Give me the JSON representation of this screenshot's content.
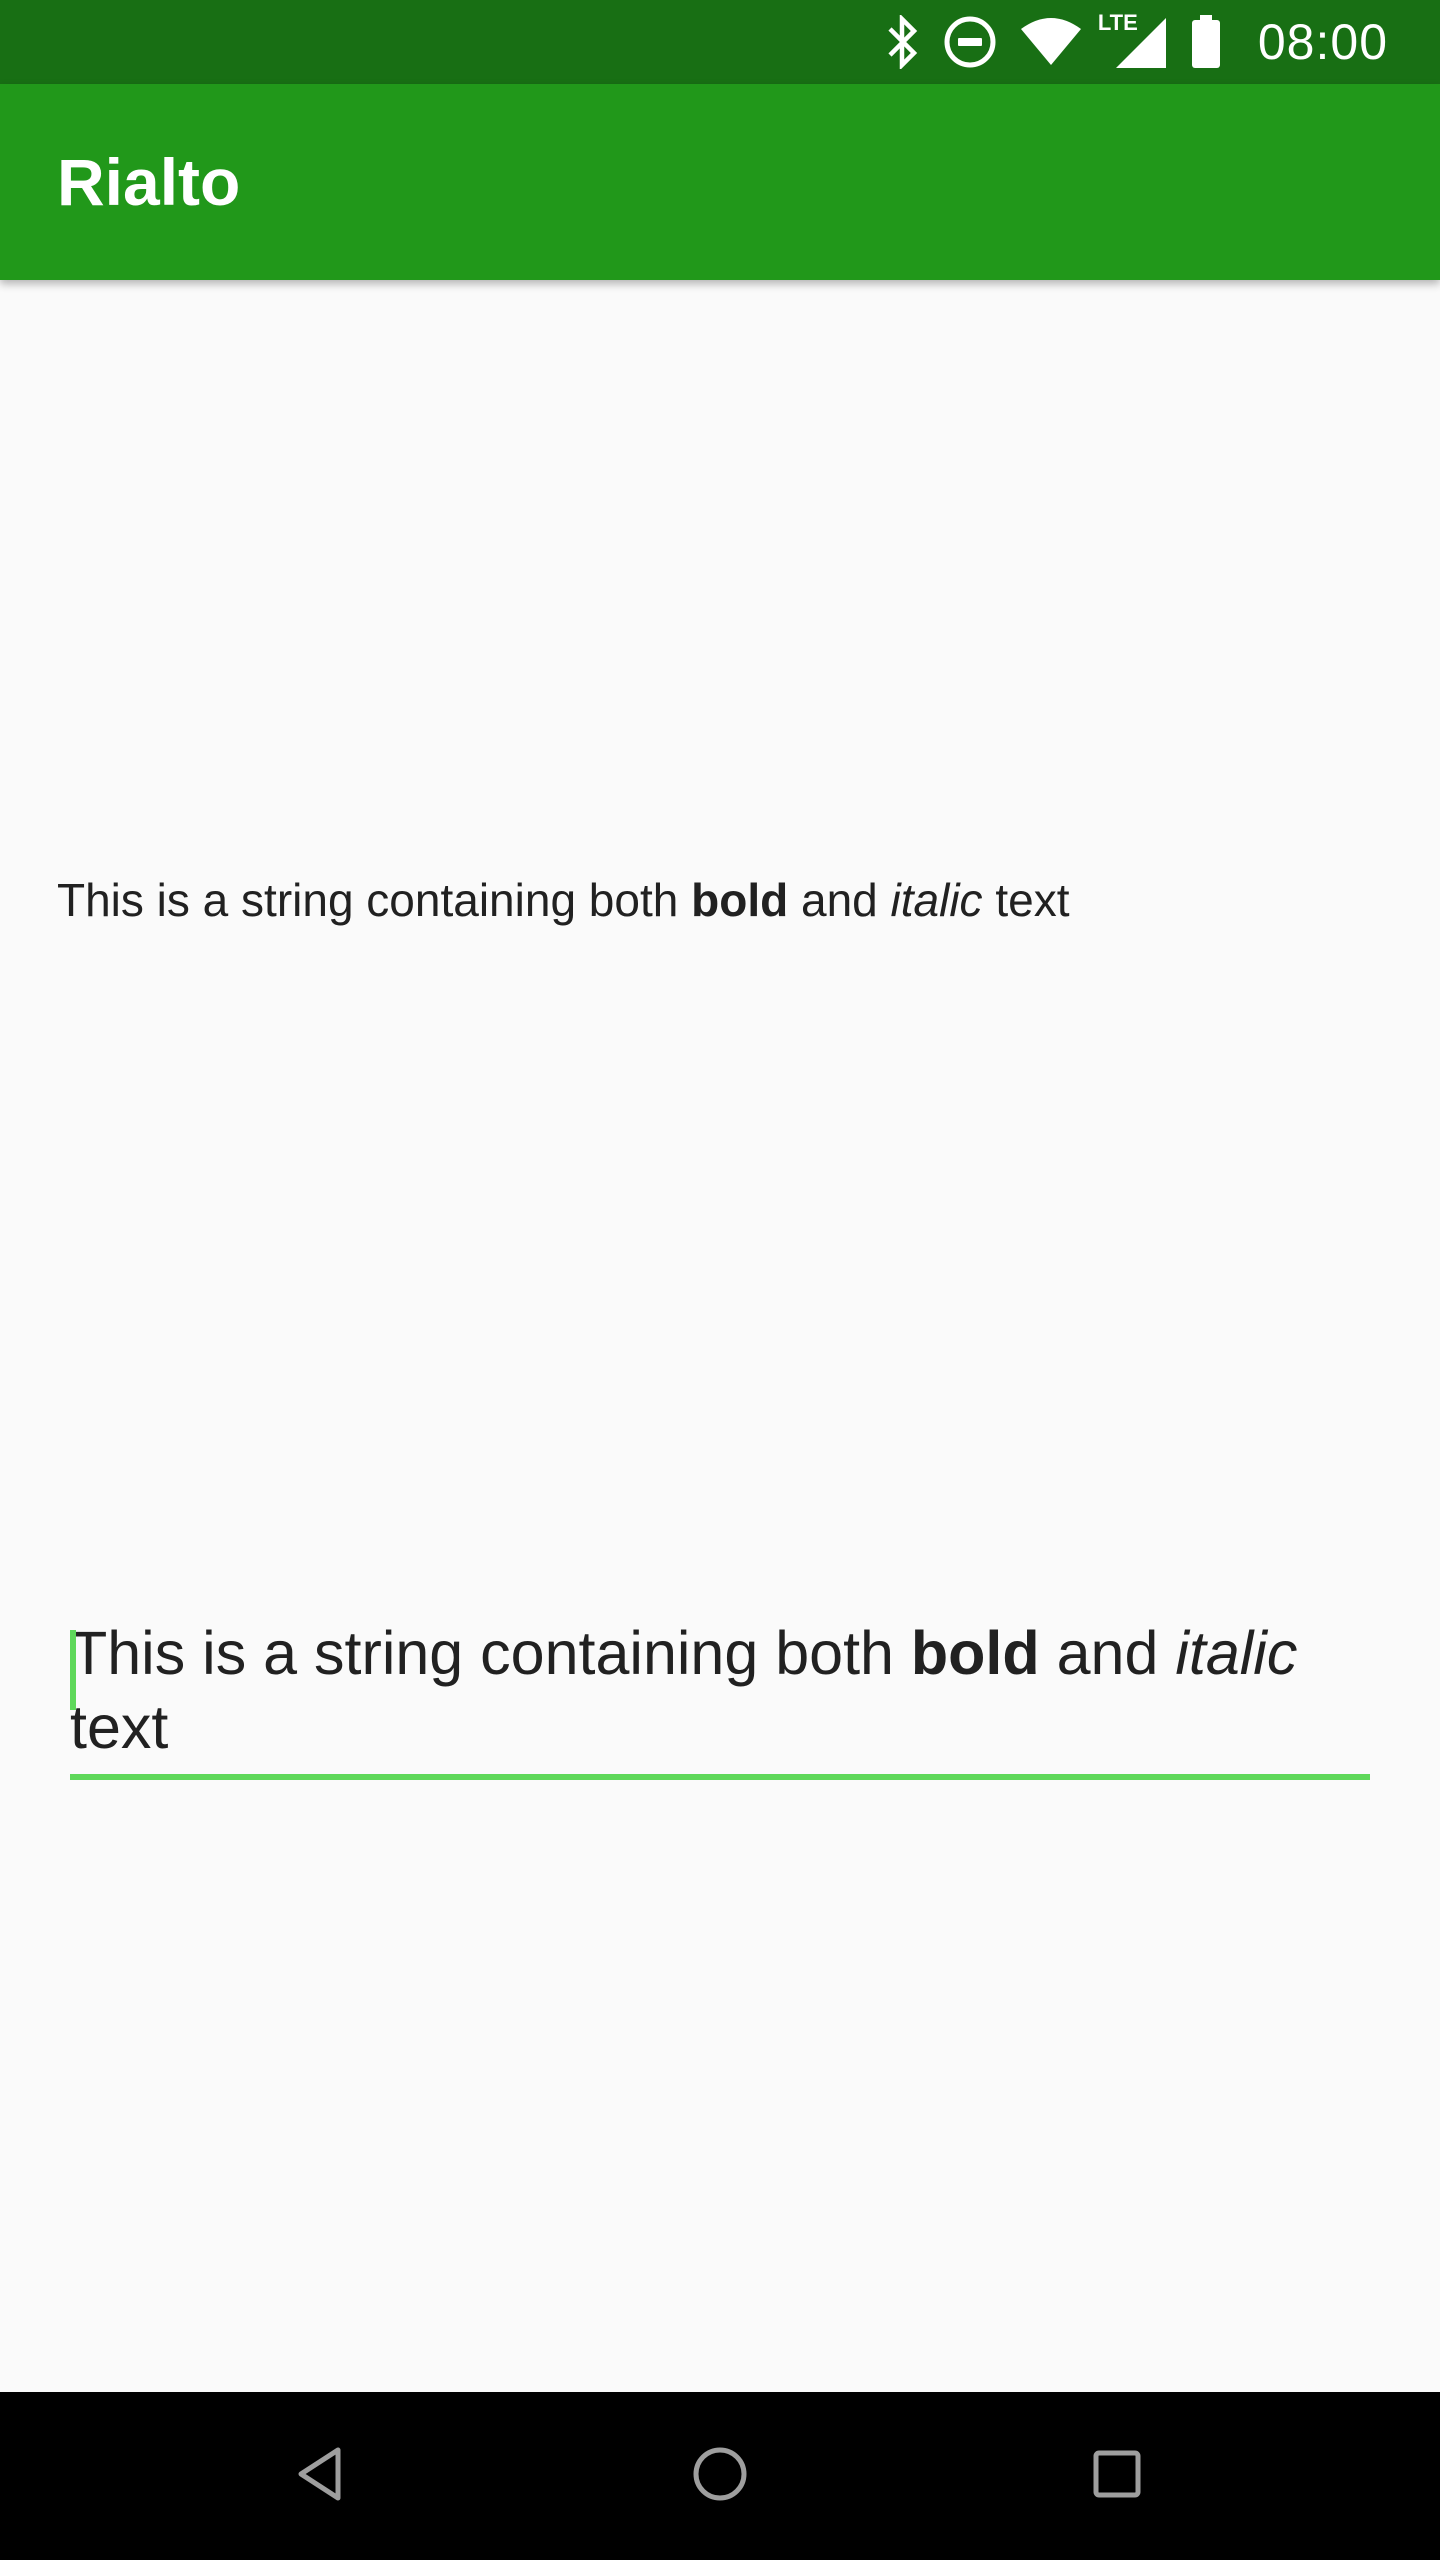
{
  "status_bar": {
    "time": "08:00",
    "icons": [
      "bluetooth-icon",
      "do-not-disturb-icon",
      "wifi-icon",
      "lte-signal-icon",
      "battery-icon"
    ],
    "lte_label": "LTE",
    "background_color": "#186f14"
  },
  "app_bar": {
    "title": "Rialto",
    "background_color": "#21981a"
  },
  "content": {
    "styled_text": {
      "part1": "This is a string containing both ",
      "bold": "bold",
      "part2": " and ",
      "italic": "italic",
      "part3": " text"
    },
    "edit_text": {
      "part1": "This is a string containing both ",
      "bold": "bold",
      "part2": " and ",
      "italic": "italic",
      "part3": " text"
    },
    "accent_color": "#5ed85a"
  },
  "nav_bar": {
    "buttons": [
      "back-icon",
      "home-icon",
      "recents-icon"
    ]
  }
}
